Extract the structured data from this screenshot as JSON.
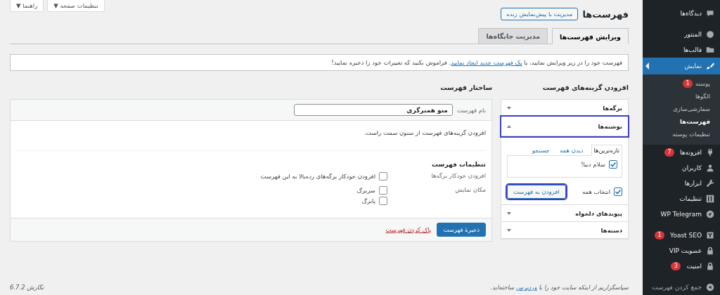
{
  "sidebar": {
    "groups": [
      [
        {
          "label": "دیدگاه‌ها",
          "selected": false
        }
      ],
      [
        {
          "label": "المنتور",
          "selected": false
        },
        {
          "label": "قالب‌ها",
          "selected": false
        },
        {
          "label": "نمایش",
          "selected": true,
          "children": [
            {
              "label": "پوسته",
              "selected": false,
              "badge": "1"
            },
            {
              "label": "الگوها",
              "selected": false
            },
            {
              "label": "سفارشی‌سازی",
              "selected": false
            },
            {
              "label": "فهرست‌ها",
              "selected": true
            },
            {
              "label": "تنظیمات پوسته",
              "selected": false
            }
          ]
        },
        {
          "label": "افزونه‌ها",
          "selected": false,
          "badge": "7"
        },
        {
          "label": "کاربران",
          "selected": false
        },
        {
          "label": "ابزارها",
          "selected": false
        },
        {
          "label": "تنظیمات",
          "selected": false
        },
        {
          "label": "WP Telegram",
          "selected": false
        }
      ],
      [
        {
          "label": "Yoast SEO",
          "selected": false,
          "badge": "1"
        },
        {
          "label": "عضویت VIP",
          "selected": false
        },
        {
          "label": "امنیت",
          "selected": false,
          "badge": "3"
        }
      ]
    ],
    "collapse": "جمع کردن فهرست"
  },
  "top_buttons": [
    "تنظیمات صفحه ▼",
    "راهنما ▼"
  ],
  "page_title": "فهرست‌ها",
  "live_preview_button": "مدیریت با پیش‌نمایش زنده",
  "tabs": [
    {
      "label": "ویرایش فهرست‌ها",
      "selected": true
    },
    {
      "label": "مدیریت جایگاه‌ها",
      "selected": false
    }
  ],
  "notice": {
    "before": "فهرست خود را در زیر ویرایش نمایید، یا ",
    "link": "یک فهرست جدید ایجاد نمایید",
    "after": ". فراموش نکنید که تغییرات خود را ذخیره نمایید!"
  },
  "add_items": {
    "title": "افزودن گزینه‌های فهرست",
    "sections": [
      {
        "label": "برگه‌ها",
        "expanded": false,
        "highlighted": false
      },
      {
        "label": "نوشته‌ها",
        "expanded": true,
        "highlighted": true,
        "tabs": [
          {
            "label": "تازه‌ترین‌ها",
            "selected": true
          },
          {
            "label": "دیدن همه",
            "selected": false
          },
          {
            "label": "جستجو",
            "selected": false
          }
        ],
        "items": [
          {
            "label": "سلام دنیا!",
            "checked": true
          }
        ],
        "select_all": {
          "label": "انتخاب همه",
          "checked": true
        },
        "add_button": {
          "label": "افزودن به فهرست",
          "highlighted": true
        }
      },
      {
        "label": "پیوندهای دلخواه",
        "expanded": false,
        "highlighted": false
      },
      {
        "label": "دسته‌ها",
        "expanded": false,
        "highlighted": false
      }
    ]
  },
  "structure": {
    "title": "ساختار فهرست",
    "name_label": "نام فهرست",
    "name_value": "منو همبرگری",
    "hint": "افزودن گزینه‌های فهرست از ستون سمت راست.",
    "settings_title": "تنظیمات فهرست",
    "settings": [
      {
        "label": "افزودن خودکار برگه‌ها",
        "options": [
          {
            "label": "افزودن خودکار برگه‌های رده‌بالا به این فهرست",
            "checked": false
          }
        ]
      },
      {
        "label": "مکان نمایش",
        "options": [
          {
            "label": "سربرگ",
            "checked": false
          },
          {
            "label": "پابرگ",
            "checked": false
          }
        ]
      }
    ],
    "save_button": "ذخیرهٔ فهرست",
    "delete_link": "پاک کردن فهرست"
  },
  "footer": {
    "before": "سپاسگزاریم از اینکه سایت خود را با ",
    "link": "وردپرس",
    "after": " ساخته‌اید.",
    "version": "نگارش 6.7.2"
  }
}
